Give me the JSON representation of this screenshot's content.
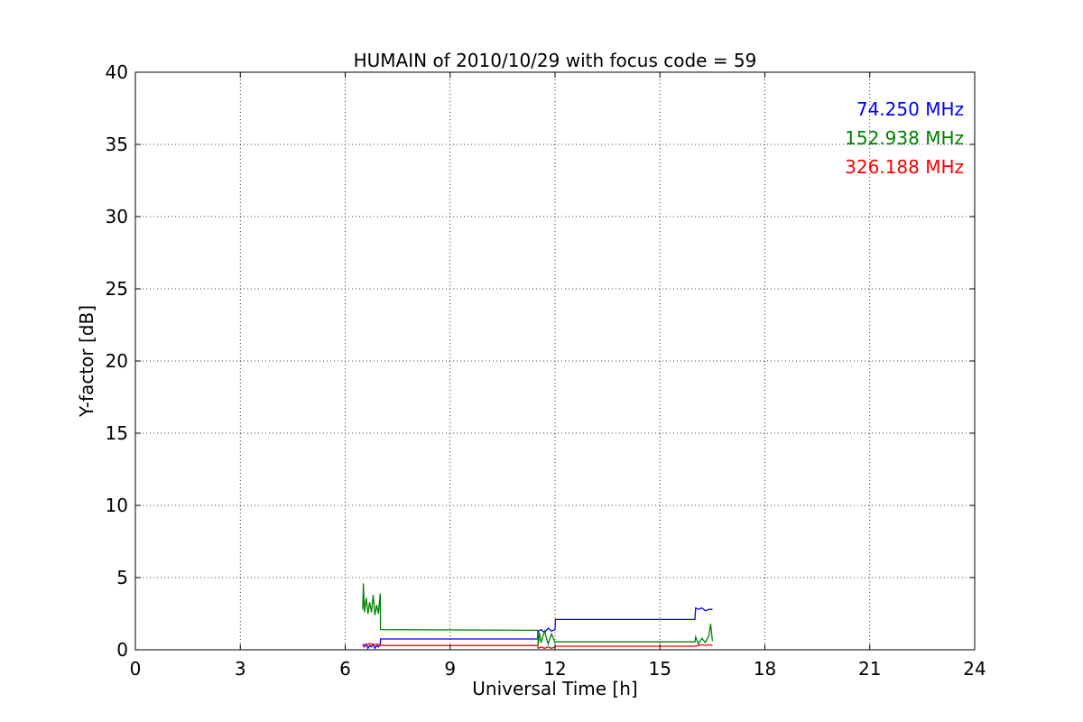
{
  "chart_data": {
    "type": "line",
    "title": "HUMAIN of 2010/10/29 with focus code = 59",
    "xlabel": "Universal Time [h]",
    "ylabel": "Y-factor [dB]",
    "xlim": [
      0,
      24
    ],
    "ylim": [
      0,
      40
    ],
    "xticks": [
      0,
      3,
      6,
      9,
      12,
      15,
      18,
      21,
      24
    ],
    "yticks": [
      0,
      5,
      10,
      15,
      20,
      25,
      30,
      35,
      40
    ],
    "grid": true,
    "legend_position": "top-right",
    "series": [
      {
        "name": "74.250 MHz",
        "color": "#0000ff",
        "x": [
          6.5,
          6.55,
          6.6,
          6.65,
          6.7,
          6.75,
          6.8,
          6.85,
          6.9,
          6.95,
          7.0,
          7.01,
          11.5,
          11.52,
          11.6,
          11.7,
          11.8,
          11.9,
          12.0,
          12.01,
          16.0,
          16.02,
          16.1,
          16.2,
          16.3,
          16.4,
          16.5
        ],
        "y": [
          0.3,
          0.2,
          0.4,
          0.1,
          0.3,
          0.2,
          0.4,
          0.1,
          0.3,
          0.2,
          0.4,
          0.75,
          0.75,
          1.3,
          1.4,
          1.2,
          1.5,
          1.3,
          1.4,
          2.1,
          2.1,
          2.9,
          2.8,
          2.9,
          2.7,
          2.8,
          2.8
        ]
      },
      {
        "name": "152.938 MHz",
        "color": "#008000",
        "x": [
          6.5,
          6.52,
          6.55,
          6.6,
          6.65,
          6.7,
          6.75,
          6.8,
          6.85,
          6.9,
          6.95,
          7.0,
          7.01,
          11.5,
          11.52,
          11.55,
          11.6,
          11.7,
          11.8,
          11.9,
          12.0,
          12.01,
          16.0,
          16.02,
          16.1,
          16.2,
          16.3,
          16.4,
          16.45,
          16.5
        ],
        "y": [
          2.8,
          4.6,
          2.6,
          3.6,
          2.5,
          3.3,
          2.6,
          3.8,
          2.4,
          3.1,
          2.5,
          3.9,
          1.4,
          1.35,
          0.3,
          1.2,
          0.5,
          1.3,
          0.4,
          1.1,
          0.5,
          0.55,
          0.55,
          0.9,
          0.4,
          0.8,
          0.5,
          1.0,
          1.8,
          0.6
        ]
      },
      {
        "name": "326.188 MHz",
        "color": "#ff0000",
        "x": [
          6.5,
          6.6,
          6.7,
          6.8,
          6.9,
          7.0,
          7.01,
          11.5,
          11.52,
          11.6,
          11.7,
          11.8,
          11.9,
          12.0,
          12.01,
          16.0,
          16.1,
          16.2,
          16.3,
          16.4,
          16.5
        ],
        "y": [
          0.4,
          0.3,
          0.45,
          0.3,
          0.4,
          0.35,
          0.3,
          0.3,
          0.1,
          0.2,
          0.1,
          0.2,
          0.1,
          0.2,
          0.25,
          0.25,
          0.3,
          0.35,
          0.3,
          0.35,
          0.3
        ]
      }
    ]
  }
}
